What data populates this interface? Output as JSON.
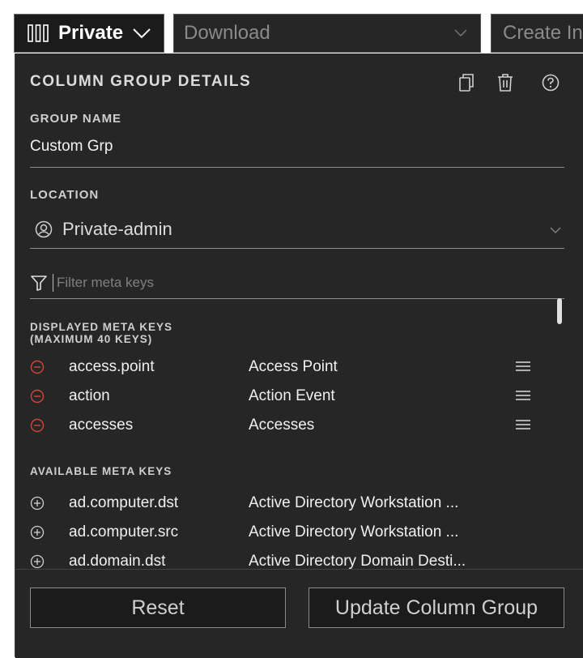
{
  "toolbar": {
    "column_group_label": "Private",
    "download_placeholder": "Download",
    "create_incident_label": "Create Incident"
  },
  "panel": {
    "title": "COLUMN GROUP DETAILS",
    "group_name_label": "GROUP NAME",
    "group_name_value": "Custom Grp",
    "location_label": "LOCATION",
    "location_value": "Private-admin",
    "filter_placeholder": "Filter meta keys",
    "displayed_label_line1": "DISPLAYED META KEYS",
    "displayed_label_line2": "(MAXIMUM 40 KEYS)",
    "displayed_keys": [
      {
        "key": "access.point",
        "name": "Access Point"
      },
      {
        "key": "action",
        "name": "Action Event"
      },
      {
        "key": "accesses",
        "name": "Accesses"
      }
    ],
    "available_label": "AVAILABLE META KEYS",
    "available_keys": [
      {
        "key": "ad.computer.dst",
        "name": "Active Directory Workstation ..."
      },
      {
        "key": "ad.computer.src",
        "name": "Active Directory Workstation ..."
      },
      {
        "key": "ad.domain.dst",
        "name": "Active Directory Domain Desti..."
      }
    ]
  },
  "footer": {
    "reset_label": "Reset",
    "update_label": "Update Column Group"
  },
  "colors": {
    "panel_bg": "#262626",
    "remove_icon": "#d4453a",
    "text": "#f0f0f0"
  },
  "icons": {
    "columns": "columns-icon",
    "copy": "copy-icon",
    "delete": "trash-icon",
    "help": "help-icon",
    "user": "user-icon",
    "filter": "funnel-icon",
    "remove": "minus-circle-icon",
    "add": "plus-circle-icon",
    "drag": "drag-handle-icon"
  }
}
